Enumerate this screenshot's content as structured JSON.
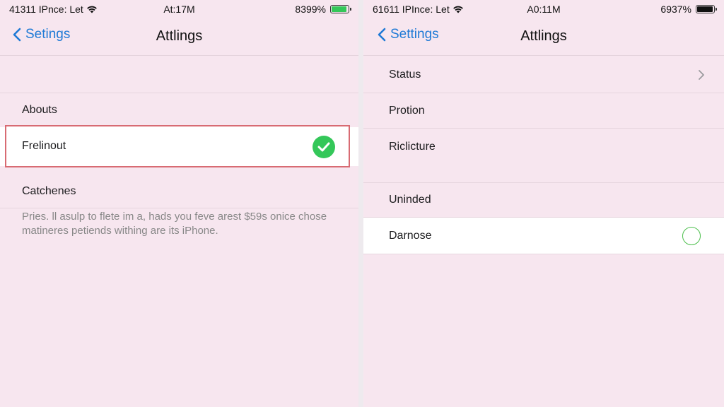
{
  "left_screen": {
    "status_bar": {
      "carrier": "41311 IPnce: Let",
      "time": "At:17M",
      "battery_percent_text": "8399%",
      "battery_fill": 0.9,
      "battery_color": "#34c759"
    },
    "nav": {
      "back_label": "Setings",
      "title": "Attlings"
    },
    "sections": {
      "abouts_label": "Abouts",
      "selected_item_label": "Frelinout",
      "catchenes_label": "Catchenes",
      "footer_note": "Pries. ll asulp to flete im a, hads you feve arest $59s onice chose matineres petiends withing are its iPhone."
    }
  },
  "right_screen": {
    "status_bar": {
      "carrier": "61611 IPInce: Let",
      "time": "A0:11M",
      "battery_percent_text": "6937%",
      "battery_fill": 0.95,
      "battery_color": "#111111"
    },
    "nav": {
      "back_label": "Settings",
      "title": "Attlings"
    },
    "items": [
      {
        "label": "Status",
        "accessory": "chevron-right"
      },
      {
        "label": "Protion"
      },
      {
        "label": "Riclicture"
      },
      {
        "label": "Uninded"
      },
      {
        "label": "Darnose",
        "accessory": "empty-circle"
      }
    ]
  },
  "colors": {
    "background": "#f7e6ef",
    "accent_blue": "#1f7ad6",
    "check_green": "#34c759",
    "highlight_red": "#d86b73"
  }
}
